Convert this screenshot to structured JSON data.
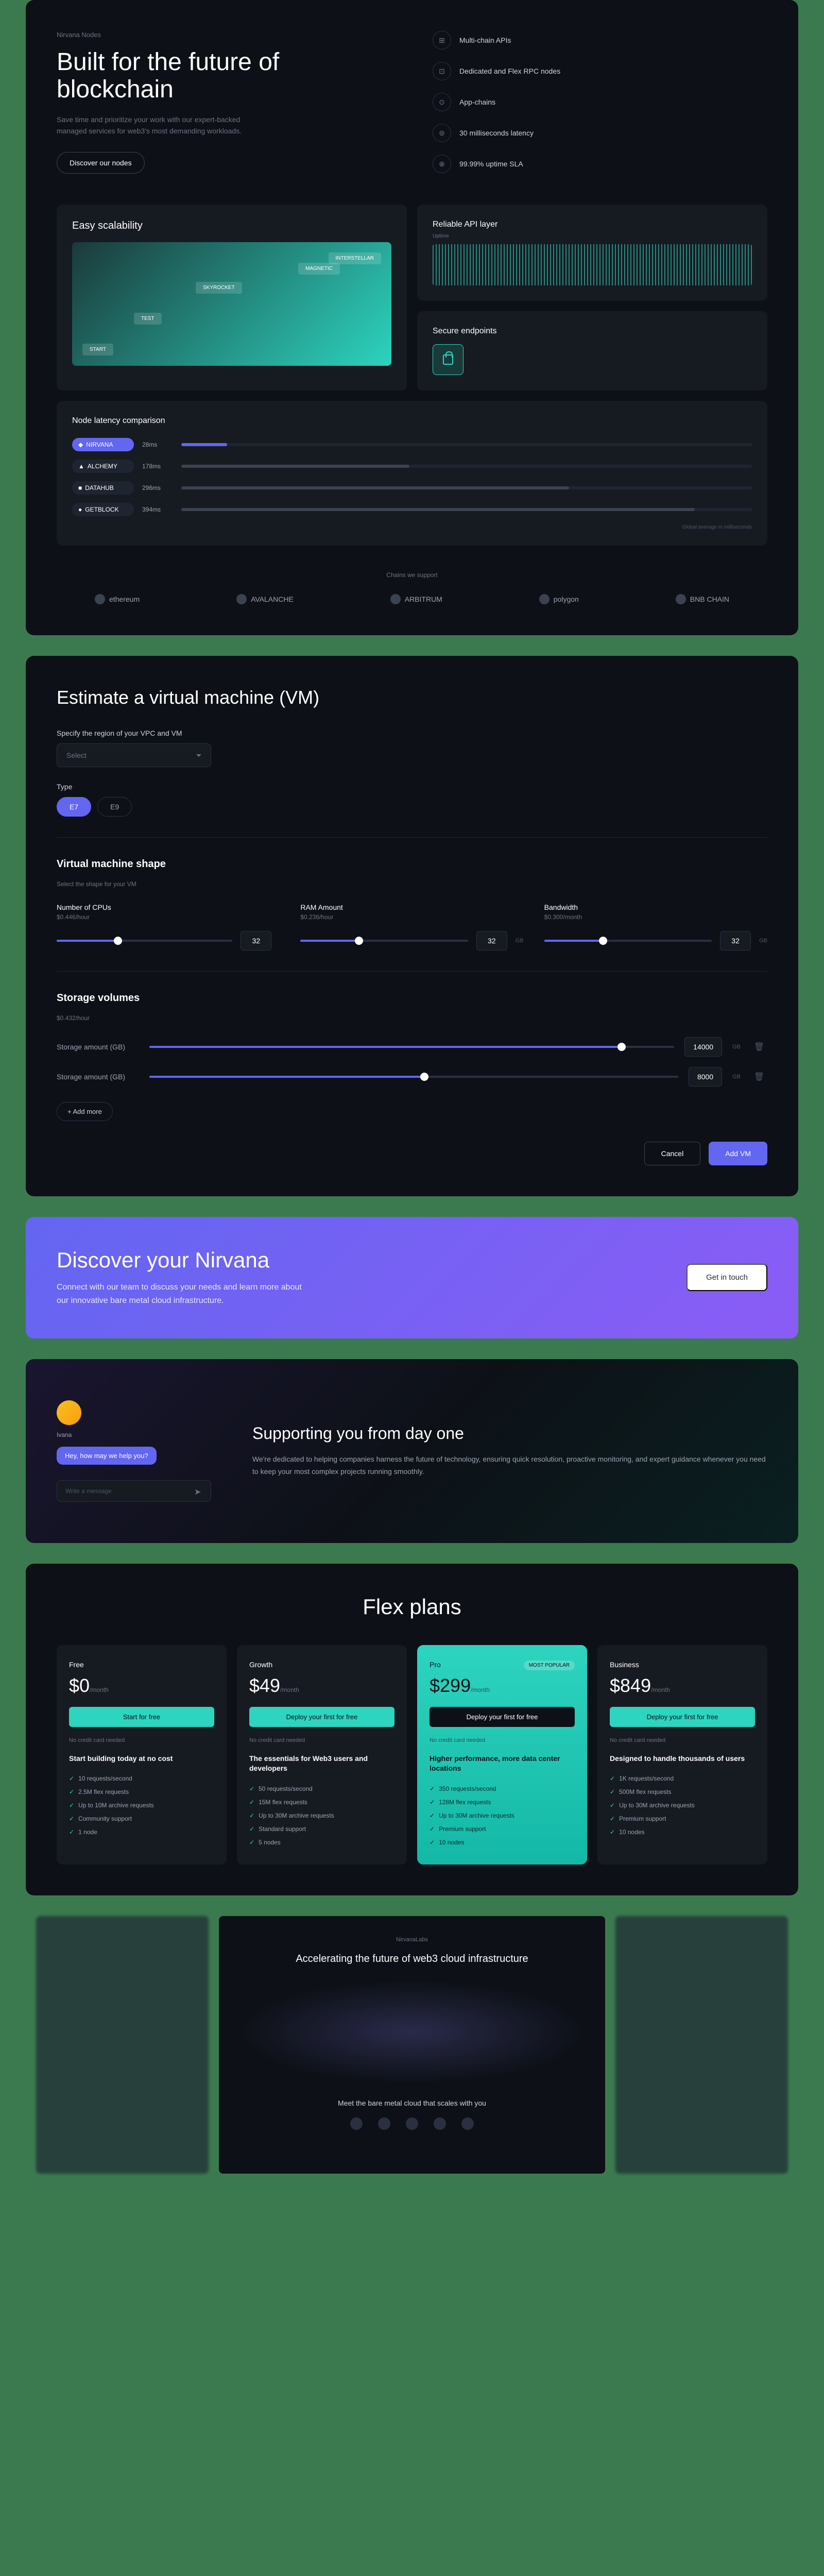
{
  "hero": {
    "eyebrow": "Nirvana Nodes",
    "title": "Built for the future of blockchain",
    "subtitle": "Save time and prioritize your work with our expert-backed managed services for web3's most demanding workloads.",
    "cta": "Discover our nodes",
    "features": [
      {
        "icon": "⊞",
        "label": "Multi-chain APIs"
      },
      {
        "icon": "⊡",
        "label": "Dedicated and Flex RPC nodes"
      },
      {
        "icon": "⊙",
        "label": "App-chains"
      },
      {
        "icon": "⊚",
        "label": "30 milliseconds latency"
      },
      {
        "icon": "⊕",
        "label": "99.99% uptime SLA"
      }
    ]
  },
  "dashboard": {
    "scalability": {
      "title": "Easy scalability",
      "nodes": [
        "START",
        "TEST",
        "SKYROCKET",
        "MAGNETIC",
        "INTERSTELLAR"
      ]
    },
    "api": {
      "title": "Reliable API layer",
      "sub": "Uptime"
    },
    "secure": {
      "title": "Secure endpoints"
    },
    "latency": {
      "title": "Node latency comparison",
      "rows": [
        {
          "name": "NIRVANA",
          "value": "28ms",
          "primary": true,
          "width": 8
        },
        {
          "name": "ALCHEMY",
          "value": "178ms",
          "primary": false,
          "width": 40
        },
        {
          "name": "DATAHUB",
          "value": "296ms",
          "primary": false,
          "width": 68
        },
        {
          "name": "GETBLOCK",
          "value": "394ms",
          "primary": false,
          "width": 90
        }
      ],
      "footnote": "Global average in milliseconds"
    }
  },
  "chains": {
    "label": "Chains we support",
    "items": [
      "ethereum",
      "AVALANCHE",
      "ARBITRUM",
      "polygon",
      "BNB CHAIN"
    ]
  },
  "vm": {
    "title": "Estimate a virtual machine (VM)",
    "region_label": "Specify the region of your VPC and VM",
    "region_placeholder": "Select",
    "type_label": "Type",
    "types": [
      "E7",
      "E9"
    ],
    "shape_title": "Virtual machine shape",
    "shape_sub": "Select the shape for your VM",
    "specs": [
      {
        "label": "Number of CPUs",
        "price": "$0.446/hour",
        "value": "32",
        "unit": "",
        "fill": 35
      },
      {
        "label": "RAM Amount",
        "price": "$0.236/hour",
        "value": "32",
        "unit": "GB",
        "fill": 35
      },
      {
        "label": "Bandwidth",
        "price": "$0.300/month",
        "value": "32",
        "unit": "GB",
        "fill": 35
      }
    ],
    "storage_title": "Storage volumes",
    "storage_price": "$0.432/hour",
    "storage_rows": [
      {
        "label": "Storage amount (GB)",
        "value": "14000",
        "unit": "GB",
        "fill": 90
      },
      {
        "label": "Storage amount (GB)",
        "value": "8000",
        "unit": "GB",
        "fill": 52
      }
    ],
    "add_more": "+ Add more",
    "cancel": "Cancel",
    "add_vm": "Add VM"
  },
  "discover": {
    "title": "Discover your Nirvana",
    "text": "Connect with our team to discuss your needs and learn more about our innovative bare metal cloud infrastructure.",
    "cta": "Get in touch"
  },
  "support": {
    "avatar_name": "Ivana",
    "bubble": "Hey, how may we help you?",
    "placeholder": "Write a message",
    "title": "Supporting you from day one",
    "text": "We're dedicated to helping companies harness the future of technology, ensuring quick resolution, proactive monitoring, and expert guidance whenever you need to keep your most complex projects running smoothly."
  },
  "pricing": {
    "title": "Flex plans",
    "plans": [
      {
        "name": "Free",
        "price": "$0",
        "unit": "/month",
        "cta": "Start for free",
        "cta_style": "green",
        "note": "No credit card needed",
        "headline": "Start building today at no cost",
        "features": [
          "10 requests/second",
          "2.5M flex requests",
          "Up to 10M archive requests",
          "Community support",
          "1 node"
        ]
      },
      {
        "name": "Growth",
        "price": "$49",
        "unit": "/month",
        "cta": "Deploy your first for free",
        "cta_style": "green",
        "note": "No credit card needed",
        "headline": "The essentials for Web3 users and developers",
        "features": [
          "50 requests/second",
          "15M flex requests",
          "Up to 30M archive requests",
          "Standard support",
          "5 nodes"
        ]
      },
      {
        "name": "Pro",
        "badge": "MOST POPULAR",
        "price": "$299",
        "unit": "/month",
        "cta": "Deploy your first for free",
        "cta_style": "dark",
        "note": "No credit card needed",
        "headline": "Higher performance, more data center locations",
        "featured": true,
        "features": [
          "350 requests/second",
          "128M flex requests",
          "Up to 30M archive requests",
          "Premium support",
          "10 nodes"
        ]
      },
      {
        "name": "Business",
        "price": "$849",
        "unit": "/month",
        "cta": "Deploy your first for free",
        "cta_style": "green",
        "note": "No credit card needed",
        "headline": "Designed to handle thousands of users",
        "features": [
          "1K requests/second",
          "500M flex requests",
          "Up to 30M archive requests",
          "Premium support",
          "10 nodes"
        ]
      }
    ]
  },
  "preview": {
    "brand": "NirvanaLabs",
    "title": "Accelerating the future of web3 cloud infrastructure",
    "sub": "Meet the bare metal cloud that scales with you"
  },
  "chart_data": {
    "type": "bar",
    "title": "Node latency comparison",
    "xlabel": "",
    "ylabel": "Global average in milliseconds",
    "categories": [
      "NIRVANA",
      "ALCHEMY",
      "DATAHUB",
      "GETBLOCK"
    ],
    "values": [
      28,
      178,
      296,
      394
    ]
  }
}
